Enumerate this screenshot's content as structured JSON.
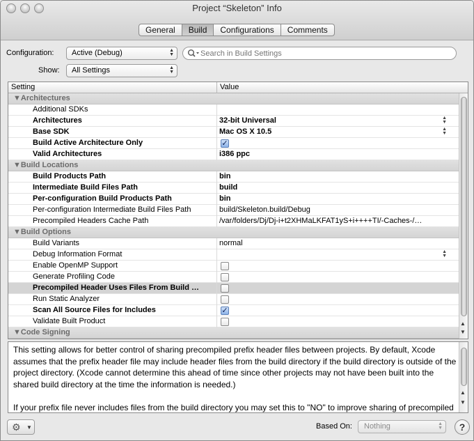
{
  "window": {
    "title": "Project “Skeleton” Info"
  },
  "tabs": [
    {
      "label": "General",
      "active": false
    },
    {
      "label": "Build",
      "active": true
    },
    {
      "label": "Configurations",
      "active": false
    },
    {
      "label": "Comments",
      "active": false
    }
  ],
  "config": {
    "configuration_label": "Configuration:",
    "configuration_value": "Active (Debug)",
    "show_label": "Show:",
    "show_value": "All Settings",
    "search_placeholder": "Search in Build Settings"
  },
  "table": {
    "col_setting": "Setting",
    "col_value": "Value",
    "rows": [
      {
        "type": "group",
        "label": "▼Architectures"
      },
      {
        "type": "item",
        "setting": "Additional SDKs",
        "value": "",
        "bold": false
      },
      {
        "type": "item",
        "setting": "Architectures",
        "value": "32-bit Universal",
        "bold": true,
        "popup": true
      },
      {
        "type": "item",
        "setting": "Base SDK",
        "value": "Mac OS X 10.5",
        "bold": true,
        "popup": true
      },
      {
        "type": "item",
        "setting": "Build Active Architecture Only",
        "value": "",
        "bold": true,
        "checkbox": true,
        "checked": true
      },
      {
        "type": "item",
        "setting": "Valid Architectures",
        "value": "i386 ppc",
        "bold": true
      },
      {
        "type": "group",
        "label": "▼Build Locations"
      },
      {
        "type": "item",
        "setting": "Build Products Path",
        "value": "bin",
        "bold": true
      },
      {
        "type": "item",
        "setting": "Intermediate Build Files Path",
        "value": "build",
        "bold": true
      },
      {
        "type": "item",
        "setting": "Per-configuration Build Products Path",
        "value": "bin",
        "bold": true
      },
      {
        "type": "item",
        "setting": "Per-configuration Intermediate Build Files Path",
        "value": "build/Skeleton.build/Debug",
        "bold": false
      },
      {
        "type": "item",
        "setting": "Precompiled Headers Cache Path",
        "value": "/var/folders/Dj/Dj-i+t2XHMaLKFAT1yS+i++++TI/-Caches-/…",
        "bold": false
      },
      {
        "type": "group",
        "label": "▼Build Options"
      },
      {
        "type": "item",
        "setting": "Build Variants",
        "value": "normal",
        "bold": false
      },
      {
        "type": "item",
        "setting": "Debug Information Format",
        "value": "",
        "bold": false,
        "popup": true
      },
      {
        "type": "item",
        "setting": "Enable OpenMP Support",
        "value": "",
        "bold": false,
        "checkbox": true,
        "checked": false
      },
      {
        "type": "item",
        "setting": "Generate Profiling Code",
        "value": "",
        "bold": false,
        "checkbox": true,
        "checked": false
      },
      {
        "type": "item",
        "setting": "Precompiled Header Uses Files From Build …",
        "value": "",
        "bold": true,
        "checkbox": true,
        "checked": false,
        "selected": true
      },
      {
        "type": "item",
        "setting": "Run Static Analyzer",
        "value": "",
        "bold": false,
        "checkbox": true,
        "checked": false
      },
      {
        "type": "item",
        "setting": "Scan All Source Files for Includes",
        "value": "",
        "bold": true,
        "checkbox": true,
        "checked": true
      },
      {
        "type": "item",
        "setting": "Validate Built Product",
        "value": "",
        "bold": false,
        "checkbox": true,
        "checked": false
      },
      {
        "type": "group",
        "label": "▼Code Signing"
      }
    ]
  },
  "description": {
    "p1": "This setting allows for better control of sharing precompiled prefix header files between projects. By default, Xcode assumes that the prefix header file may include header files from the build directory if the build directory is outside of the project directory. (Xcode cannot determine this ahead of time since other projects may not have been built into the shared build directory at the time the information is needed.)",
    "p2": "If your prefix file never includes files from the build directory you may set this to \"NO\" to improve sharing of precompiled headers. If the prefix does use files from a build directory which is inside your project directory, you may"
  },
  "bottom": {
    "based_on_label": "Based On:",
    "based_on_value": "Nothing",
    "help_label": "?"
  }
}
